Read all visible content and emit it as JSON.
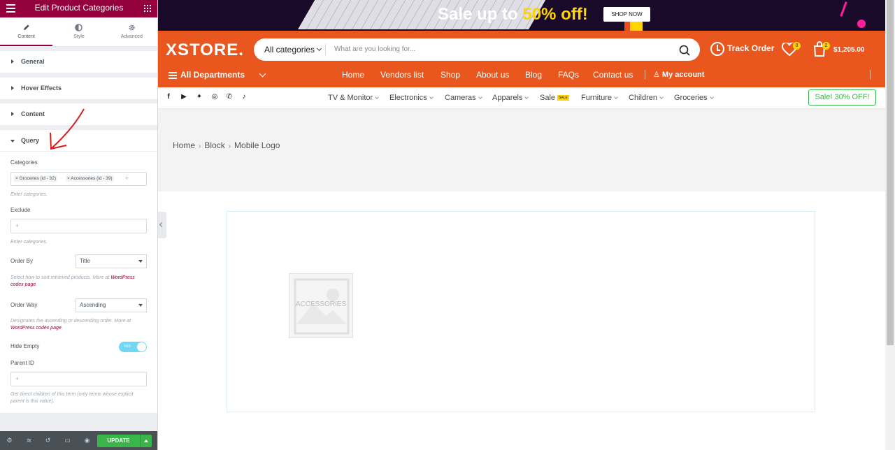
{
  "editor": {
    "title": "Edit Product Categories",
    "tabs": [
      {
        "label": "Content",
        "icon": "pencil-icon"
      },
      {
        "label": "Style",
        "icon": "half-circle-icon"
      },
      {
        "label": "Advanced",
        "icon": "gear-icon"
      }
    ],
    "sections": [
      "General",
      "Hover Effects",
      "Content",
      "Query"
    ],
    "query": {
      "categories_label": "Categories",
      "categories_tags": [
        "Groceries (id - 32)",
        "Accessories (id - 39)"
      ],
      "categories_hint": "Enter categories.",
      "exclude_label": "Exclude",
      "exclude_hint": "Enter categories.",
      "order_by_label": "Order By",
      "order_by_value": "Title",
      "order_by_hint": "Select how to sort retrieved products. More at",
      "order_by_link": "WordPress codex page",
      "order_way_label": "Order Way",
      "order_way_value": "Ascending",
      "order_way_hint": "Designates the ascending or descending order. More at",
      "order_way_link": "WordPress codex page",
      "hide_empty_label": "Hide Empty",
      "hide_empty_state": "Yes",
      "parent_id_label": "Parent ID",
      "parent_id_hint": "Get direct children of this term (only terms whose explicit parent is this value)."
    },
    "footer": {
      "update_label": "UPDATE"
    },
    "accent_color": "#93003c"
  },
  "promo": {
    "sale_text": "Sale up to ",
    "sale_highlight": "50% off!",
    "shop_now": "SHOP NOW"
  },
  "header": {
    "logo": "XSTORE.",
    "search": {
      "category": "All categories",
      "placeholder": "What are you looking for..."
    },
    "track_order": "Track Order",
    "wishlist_count": "0",
    "cart_count": "2",
    "cart_total": "$1,205.00",
    "departments": "All Departments",
    "nav": [
      "Home",
      "Vendors list",
      "Shop",
      "About us",
      "Blog",
      "FAQs",
      "Contact us"
    ],
    "account": "My account",
    "brand_color": "#e9571f"
  },
  "catbar": {
    "social": [
      "facebook-icon",
      "youtube-icon",
      "twitter-icon",
      "instagram-icon",
      "whatsapp-icon",
      "tiktok-icon"
    ],
    "items": [
      "TV & Monitor",
      "Electronics",
      "Cameras",
      "Apparels",
      "Sale",
      "Furniture",
      "Children",
      "Groceries"
    ],
    "sale_badge": "SALE",
    "sale_button": "Sale! 30% OFF!"
  },
  "breadcrumb": [
    "Home",
    "Block",
    "Mobile Logo"
  ],
  "widget": {
    "placeholder_caption": "ACCESSORIES"
  }
}
